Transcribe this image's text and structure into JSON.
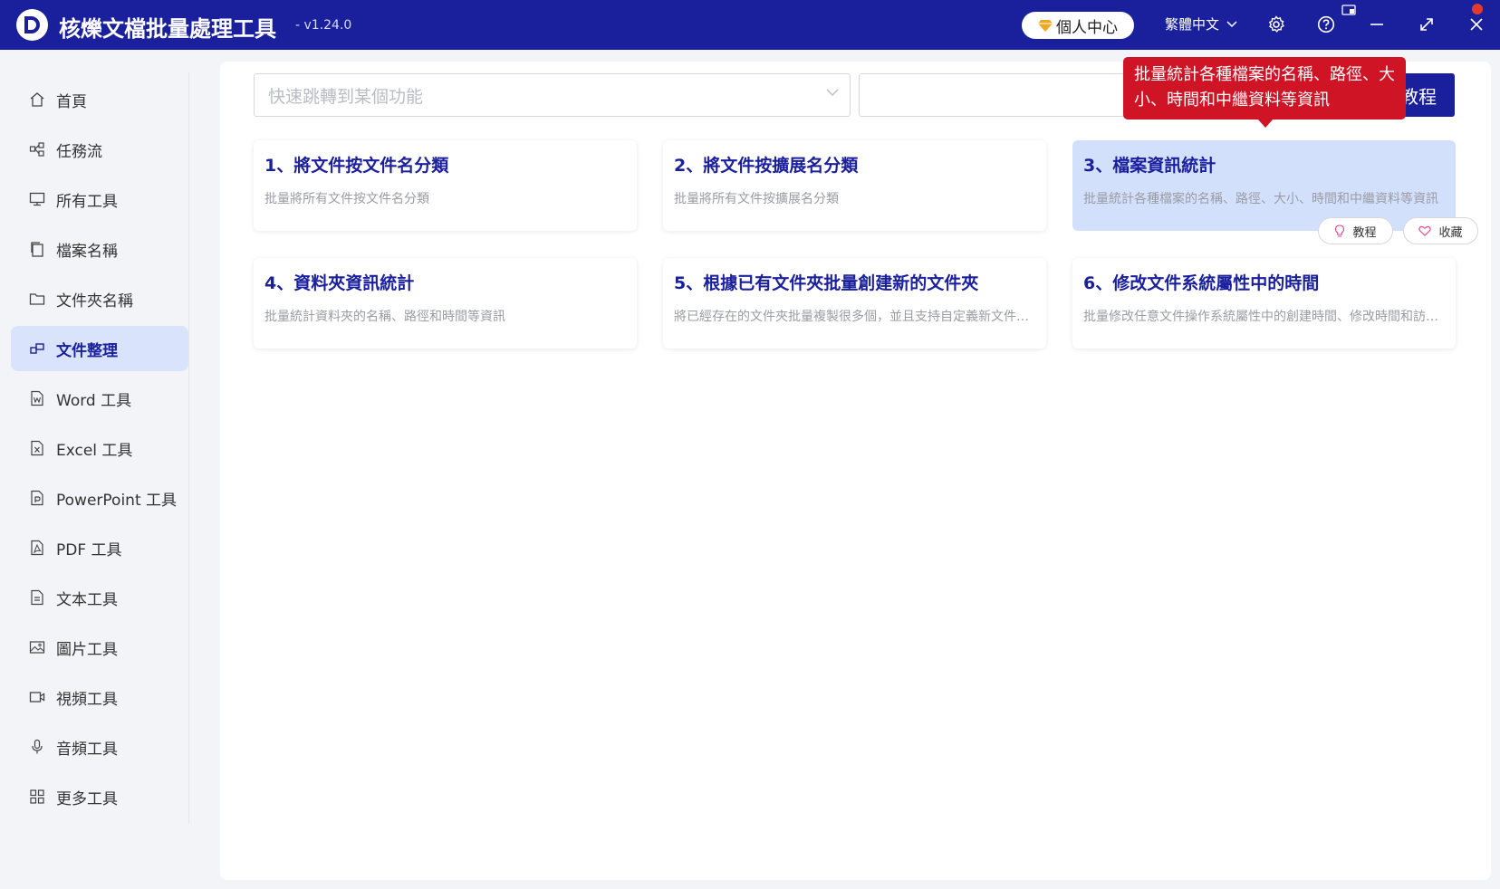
{
  "header": {
    "title": "核爍文檔批量處理工具",
    "version": "- v1.24.0",
    "personal_center": "個人中心",
    "language": "繁體中文"
  },
  "sidebar": {
    "items": [
      {
        "label": "首頁",
        "icon": "home-icon"
      },
      {
        "label": "任務流",
        "icon": "workflow-icon"
      },
      {
        "label": "所有工具",
        "icon": "monitor-icon"
      },
      {
        "label": "檔案名稱",
        "icon": "file-copy-icon"
      },
      {
        "label": "文件夾名稱",
        "icon": "folder-icon"
      },
      {
        "label": "文件整理",
        "icon": "organize-icon",
        "active": true
      },
      {
        "label": "Word 工具",
        "icon": "word-icon"
      },
      {
        "label": "Excel 工具",
        "icon": "excel-icon"
      },
      {
        "label": "PowerPoint 工具",
        "icon": "powerpoint-icon"
      },
      {
        "label": "PDF 工具",
        "icon": "pdf-icon"
      },
      {
        "label": "文本工具",
        "icon": "text-file-icon"
      },
      {
        "label": "圖片工具",
        "icon": "image-icon"
      },
      {
        "label": "視頻工具",
        "icon": "video-icon"
      },
      {
        "label": "音頻工具",
        "icon": "microphone-icon"
      },
      {
        "label": "更多工具",
        "icon": "grid-icon"
      }
    ]
  },
  "search": {
    "placeholder": "快速跳轉到某個功能",
    "tutorial_label": "教程"
  },
  "tooltip": {
    "text": "批量統計各種檔案的名稱、路徑、大小、時間和中繼資料等資訊"
  },
  "cards": [
    {
      "title": "1、將文件按文件名分類",
      "desc": "批量將所有文件按文件名分類"
    },
    {
      "title": "2、將文件按擴展名分類",
      "desc": "批量將所有文件按擴展名分類"
    },
    {
      "title": "3、檔案資訊統計",
      "desc": "批量統計各種檔案的名稱、路徑、大小、時間和中繼資料等資訊"
    },
    {
      "title": "4、資料夾資訊統計",
      "desc": "批量統計資料夾的名稱、路徑和時間等資訊"
    },
    {
      "title": "5、根據已有文件夾批量創建新的文件夾",
      "desc": "將已經存在的文件夾批量複製很多個，並且支持自定義新文件夾名稱"
    },
    {
      "title": "6、修改文件系統屬性中的時間",
      "desc": "批量修改任意文件操作系統屬性中的創建時間、修改時間和訪問時間"
    }
  ],
  "card_actions": {
    "tutorial": "教程",
    "favorite": "收藏"
  },
  "colors": {
    "brand": "#1a1f9c",
    "tooltip": "#cf1426",
    "active_bg": "#d9e3fb"
  }
}
